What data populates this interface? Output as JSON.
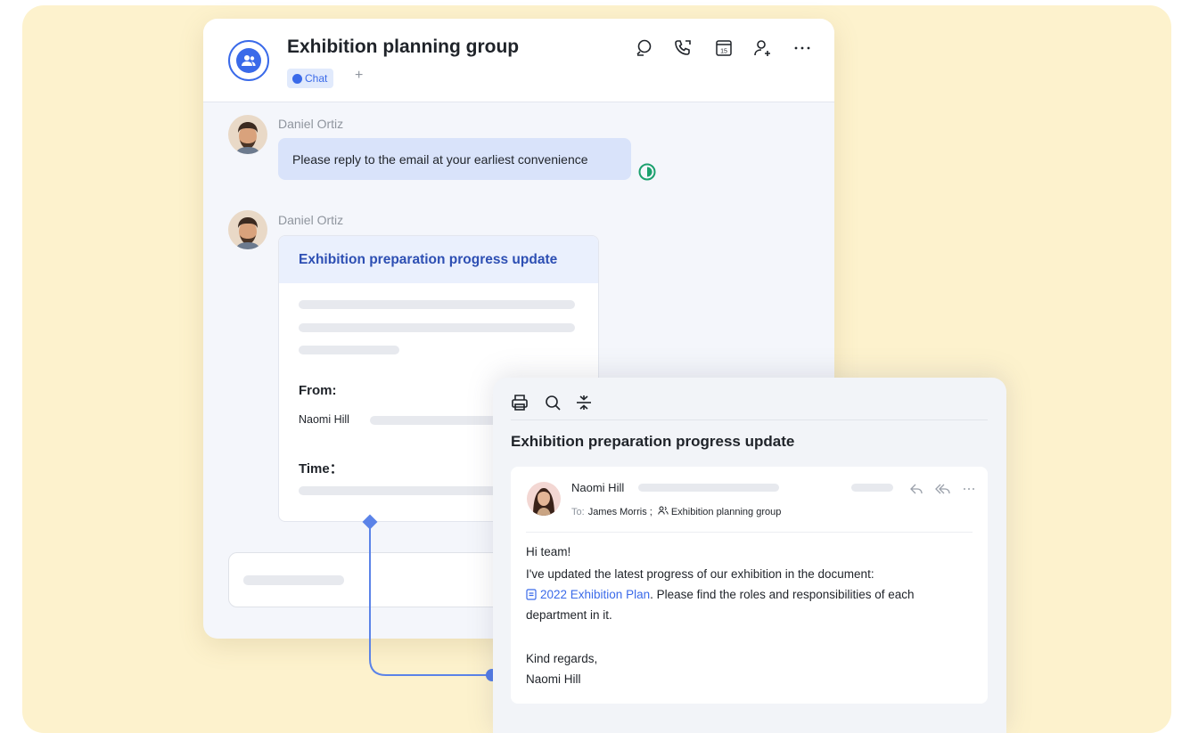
{
  "chat": {
    "title": "Exhibition planning group",
    "tab_label": "Chat",
    "add_tab": "+",
    "icons": [
      "search-icon",
      "phone-icon",
      "calendar-icon",
      "add-member-icon",
      "more-icon"
    ],
    "messages": [
      {
        "sender": "Daniel Ortiz",
        "text": "Please reply to the email at your earliest convenience"
      },
      {
        "sender": "Daniel Ortiz",
        "card": {
          "title": "Exhibition preparation progress update",
          "from_label": "From:",
          "from_name": "Naomi Hill",
          "time_label": "Time："
        }
      }
    ]
  },
  "email": {
    "toolbar_icons": [
      "print-icon",
      "search-icon",
      "collapse-icon"
    ],
    "subject": "Exhibition preparation progress update",
    "from_name": "Naomi Hill",
    "to_label": "To:",
    "to_recipients": "James Morris ;",
    "to_group": "Exhibition planning group",
    "actions": [
      "reply-icon",
      "reply-all-icon",
      "more-icon"
    ],
    "body": {
      "greeting": "Hi team!",
      "line1": "I've updated the latest progress of our exhibition in the document:",
      "doc_link": "2022 Exhibition Plan",
      "line2_rest": ". Please find the roles and responsibilities of each",
      "line3": "department in it.",
      "closing": "Kind regards,",
      "signature": "Naomi Hill"
    }
  },
  "colors": {
    "accent": "#3a6ae9",
    "background": "#fdf2cd",
    "bubble": "#d9e3fa",
    "read_status": "#1aa06d"
  }
}
